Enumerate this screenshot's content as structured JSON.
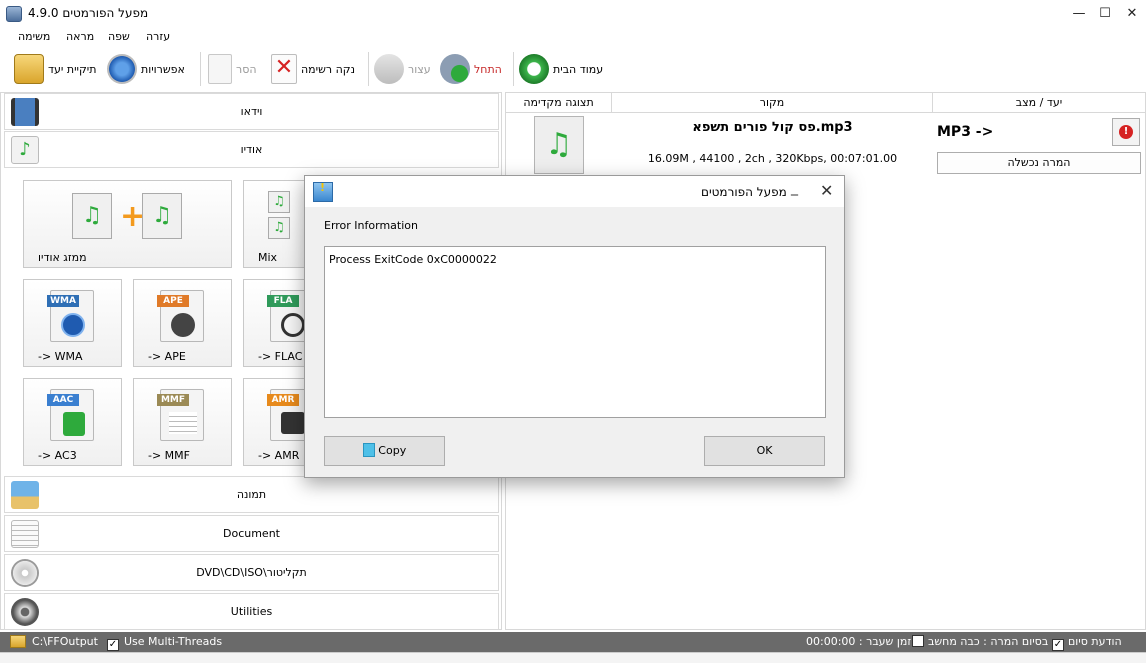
{
  "window": {
    "title": "מפעל הפורמטים 4.9.0",
    "controls": {
      "minimize": "—",
      "maximize": "☐",
      "close": "✕"
    }
  },
  "menu": [
    "משימה",
    "מראה",
    "שפה",
    "עזרה"
  ],
  "toolbar": {
    "output_folder": "תיקיית יעד",
    "options": "אפשרויות",
    "remove": "הסר",
    "clear_list": "נקה רשימה",
    "stop": "עצור",
    "start": "התחל",
    "home": "עמוד הבית"
  },
  "categories": {
    "video": "וידאו",
    "audio": "אודיו",
    "picture": "תמונה",
    "document": "Document",
    "rom": "DVD\\CD\\ISO\\תקליטור",
    "utilities": "Utilities"
  },
  "audio_tiles": {
    "merger": "ממזג אודיו",
    "mix": "Mix",
    "wma": "-> WMA",
    "ape": "-> APE",
    "flac": "-> FLAC",
    "ac3": "-> AC3",
    "mmf": "-> MMF",
    "amr": "-> AMR",
    "badges": {
      "wma": "WMA",
      "ape": "APE",
      "fla": "FLA",
      "aac": "AAC",
      "mmf": "MMF",
      "amr": "AMR"
    }
  },
  "task_table": {
    "headers": {
      "preview": "תצוגה מקדימה",
      "source": "מקור",
      "output": "יעד / מצב"
    },
    "rows": [
      {
        "filename": "פס קול פורים תשפא.mp3",
        "details": "16.09M , 44100 , 2ch , 320Kbps, 00:07:01.00",
        "target": "MP3 ->",
        "status": "המרה נכשלה"
      }
    ]
  },
  "statusbar": {
    "output_path": "C:\\FFOutput",
    "multithread_label": "Use Multi-Threads",
    "multithread_checked": true,
    "elapsed": "זמן שעבר : 00:00:00",
    "shutdown_label": "בסיום המרה : כבה מחשב",
    "shutdown_checked": false,
    "notify_label": "הודעת סיום",
    "notify_checked": true
  },
  "dialog": {
    "title": "מפעל הפורמטים",
    "section": "Error Information",
    "message": "Process ExitCode 0xC0000022",
    "copy_button": "Copy",
    "ok_button": "OK"
  },
  "colors": {
    "accent_green": "#2eaa3c",
    "error_red": "#d62222",
    "status_bar": "#6a6a6a",
    "start_text": "#c62828"
  }
}
